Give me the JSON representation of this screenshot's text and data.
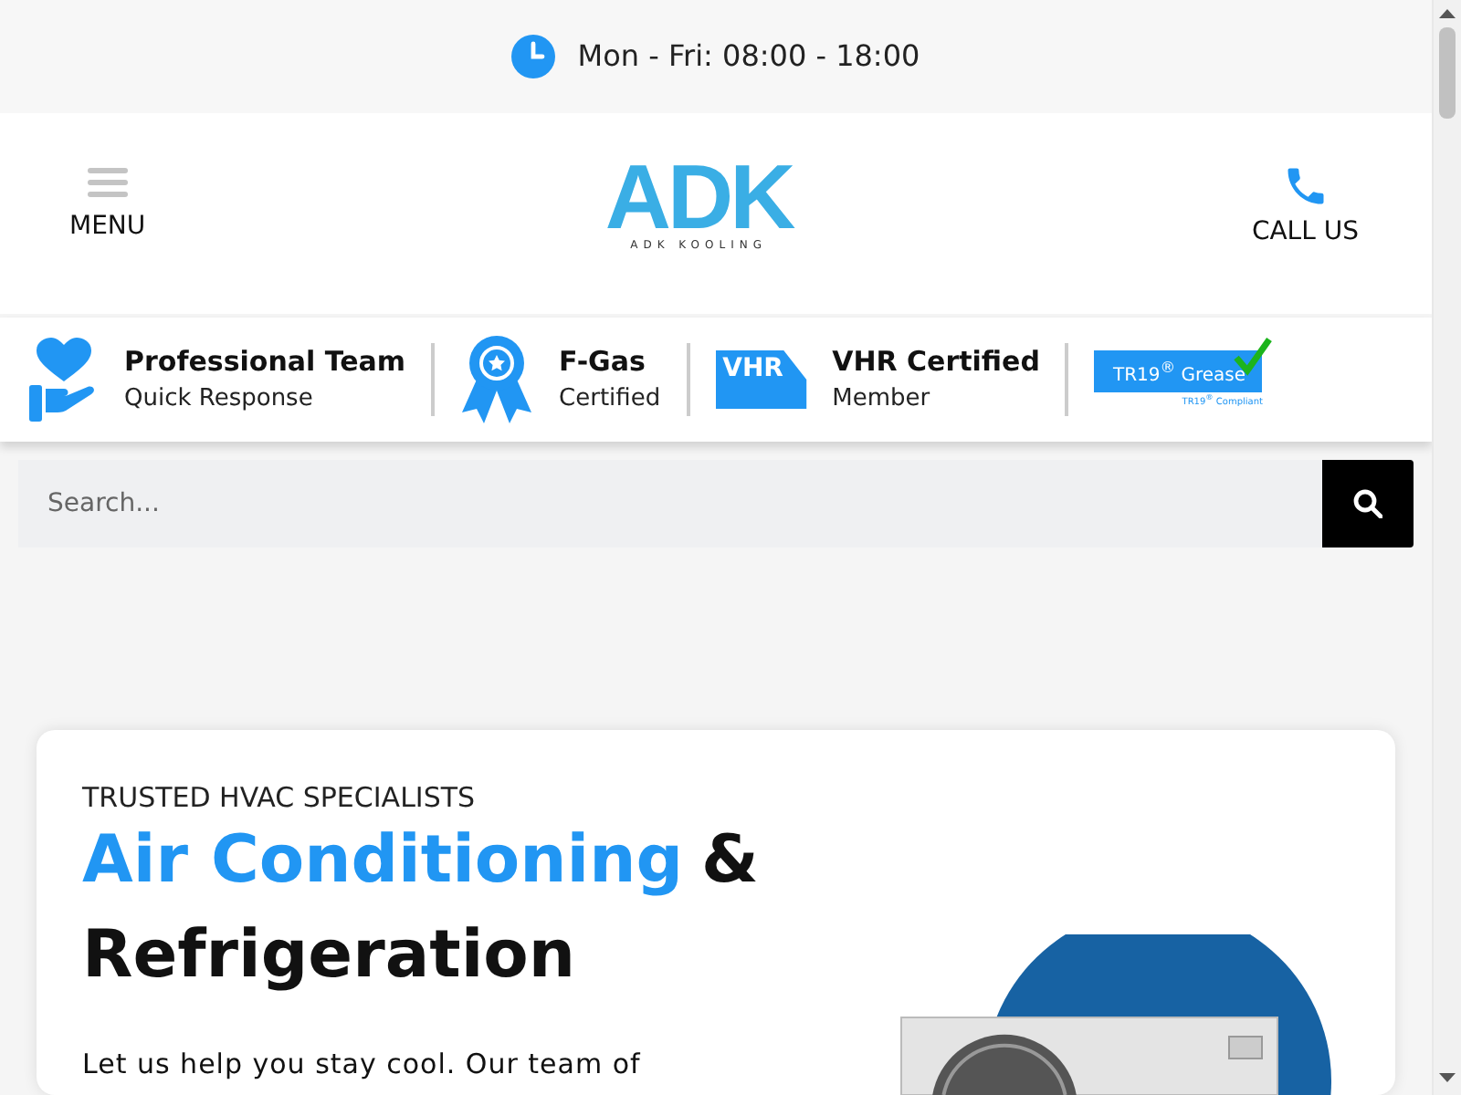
{
  "top_bar": {
    "hours": "Mon - Fri: 08:00 - 18:00"
  },
  "header": {
    "menu_label": "MENU",
    "logo": {
      "mark": "ADK",
      "tagline": "ADK KOOLING"
    },
    "call_label": "CALL US"
  },
  "badges": [
    {
      "kind": "heart",
      "title": "Professional Team",
      "subtitle": "Quick Response"
    },
    {
      "kind": "ribbon",
      "title": "F-Gas",
      "subtitle": "Certified"
    },
    {
      "kind": "vhr",
      "logo_text": "VHR",
      "title": "VHR Certified",
      "subtitle": "Member"
    },
    {
      "kind": "tr19",
      "logo_text": "TR19$^{®}$ Grease",
      "logo_subtext": "TR19$^{®}$ Compliant"
    }
  ],
  "search": {
    "placeholder": "Search..."
  },
  "hero": {
    "eyebrow": "TRUSTED HVAC SPECIALISTS",
    "heading_highlight": "Air Conditioning",
    "heading_rest": "&",
    "heading_line2": "Refrigeration",
    "body": "Let us help you stay cool. Our team of"
  }
}
